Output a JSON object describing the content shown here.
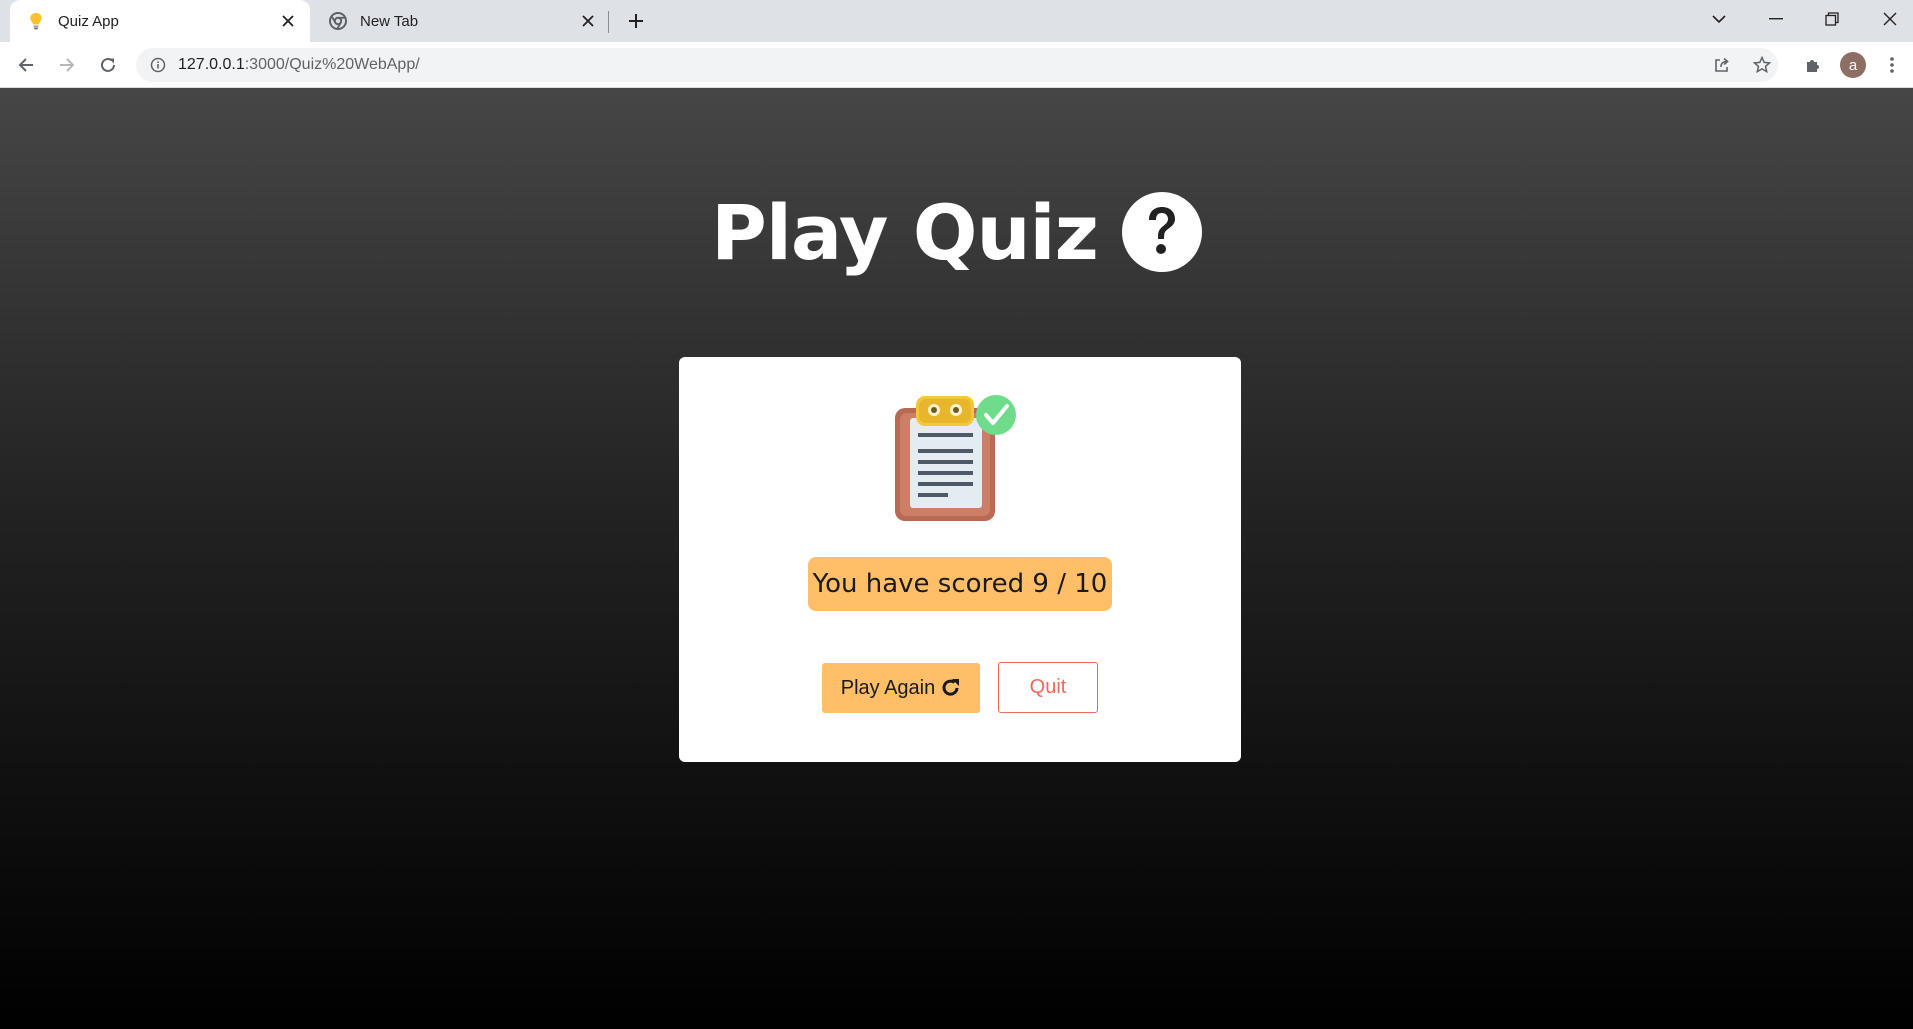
{
  "browser": {
    "tabs": [
      {
        "title": "Quiz App",
        "favicon": "lightbulb-icon",
        "active": true
      },
      {
        "title": "New Tab",
        "favicon": "chrome-icon",
        "active": false
      }
    ],
    "url": {
      "host": "127.0.0.1",
      "path": ":3000/Quiz%20WebApp/"
    },
    "profile_initial": "a"
  },
  "page": {
    "heading": "Play Quiz",
    "heading_icon": "question-circle-icon",
    "illustration": "clipboard-checklist-icon",
    "score_text": "You have scored 9 / 10",
    "play_again_label": "Play Again",
    "play_again_icon": "reload-icon",
    "quit_label": "Quit"
  },
  "colors": {
    "accent": "#ffbf69",
    "quit": "#f06a5a",
    "card": "#ffffff"
  }
}
